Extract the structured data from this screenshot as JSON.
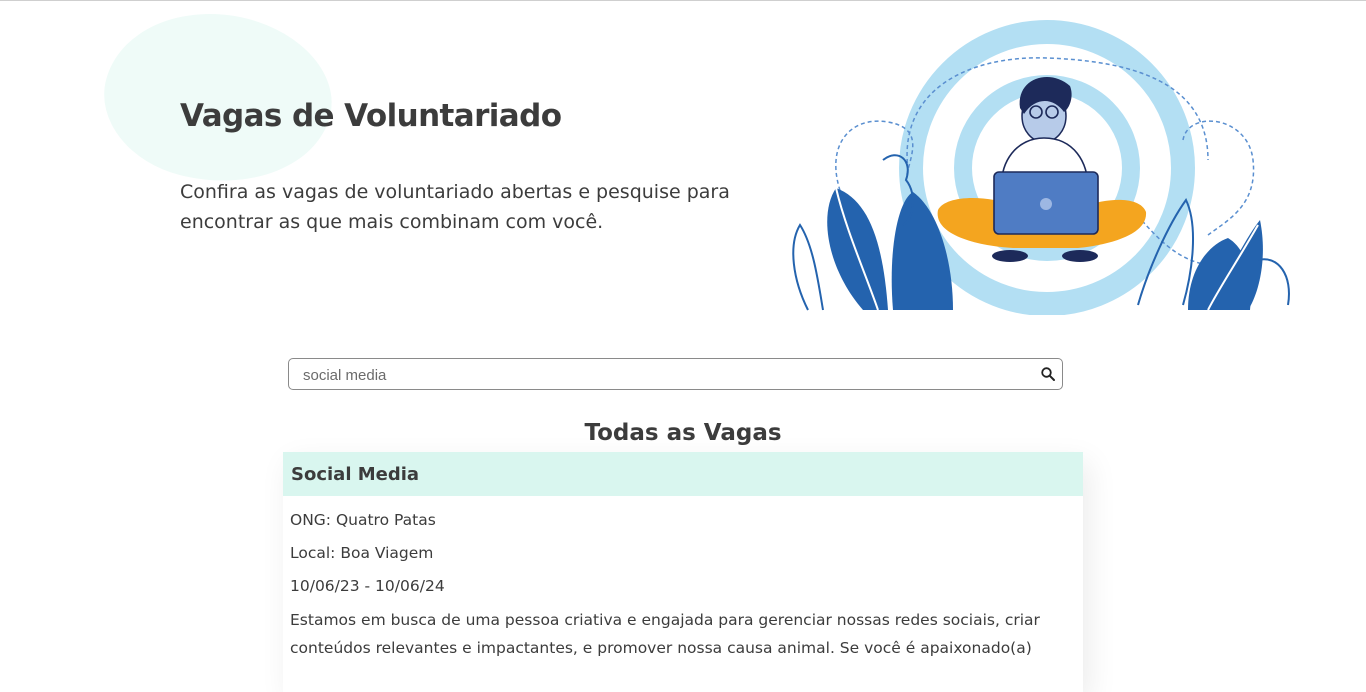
{
  "hero": {
    "title": "Vagas de Voluntariado",
    "subtitle": "Confira as vagas de voluntariado abertas e pesquise para encontrar as que mais combinam com você."
  },
  "search": {
    "value": "social media",
    "icon": "search-icon"
  },
  "listing": {
    "section_title": "Todas as Vagas",
    "cards": [
      {
        "title": "Social Media",
        "ong": "ONG: Quatro Patas",
        "local": "Local: Boa Viagem",
        "dates": "10/06/23 - 10/06/24",
        "description": "Estamos em busca de uma pessoa criativa e engajada para gerenciar nossas redes sociais, criar conteúdos relevantes e impactantes, e promover nossa causa animal. Se você é apaixonado(a)"
      }
    ]
  },
  "colors": {
    "accent_mint": "#d9f6ef",
    "blob": "#effbf8",
    "illustration_blue": "#2463ae",
    "illustration_light_blue": "#b3dff3",
    "illustration_orange": "#f4a51f"
  }
}
